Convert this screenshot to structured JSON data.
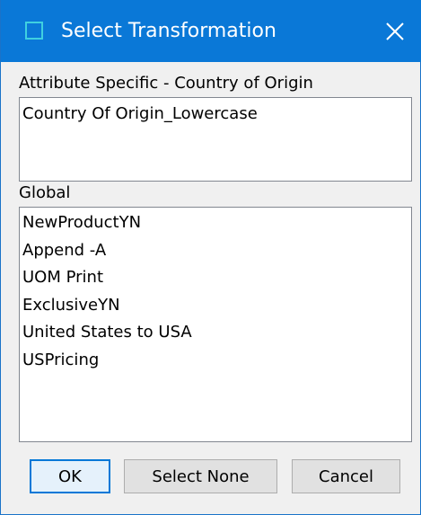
{
  "dialog": {
    "title": "Select Transformation",
    "close_label": "✕"
  },
  "attribute_section": {
    "label": "Attribute Specific - Country of Origin",
    "items": [
      "Country Of Origin_Lowercase"
    ]
  },
  "global_section": {
    "label": "Global",
    "items": [
      "NewProductYN",
      "Append -A",
      "UOM Print",
      "ExclusiveYN",
      "United States to USA",
      "USPricing"
    ]
  },
  "buttons": {
    "ok_label": "OK",
    "select_none_label": "Select None",
    "cancel_label": "Cancel"
  },
  "colors": {
    "titlebar": "#0a78d7",
    "dialog_bg": "#f0f0f0",
    "default_button_border": "#0078d7"
  }
}
